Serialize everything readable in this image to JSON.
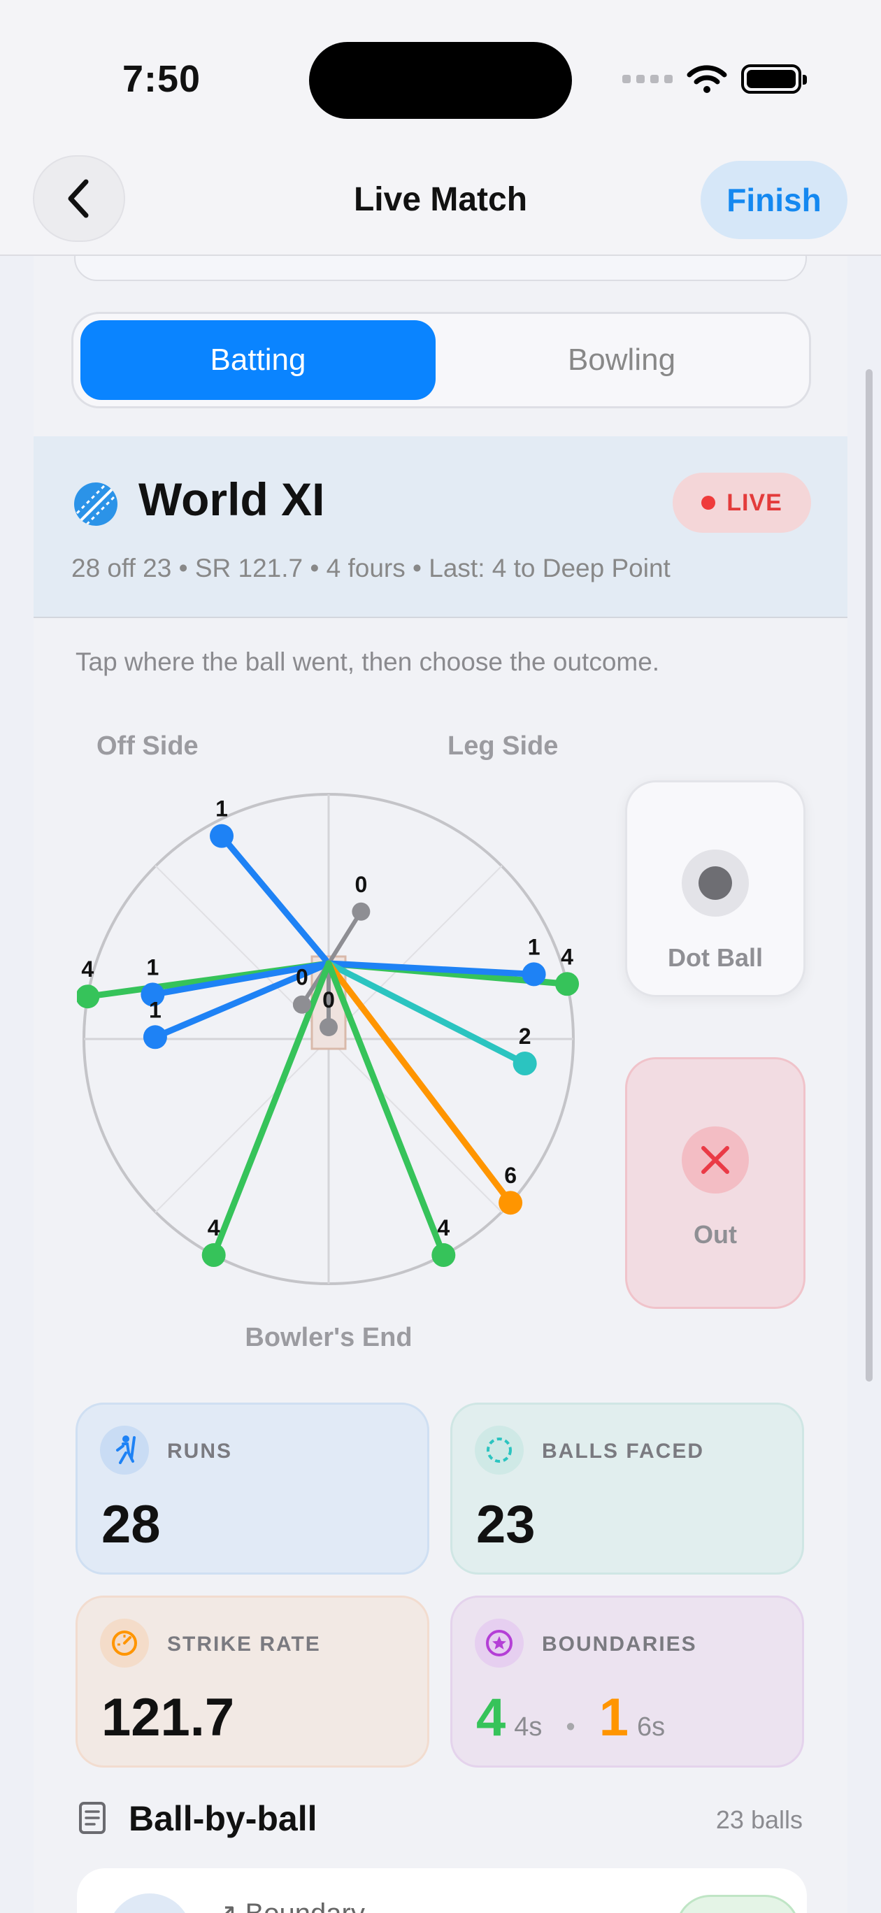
{
  "status": {
    "time": "7:50"
  },
  "nav": {
    "title": "Live Match",
    "finish": "Finish"
  },
  "tabs": {
    "batting": "Batting",
    "bowling": "Bowling"
  },
  "team": {
    "name": "World XI",
    "live": "LIVE",
    "stats": "28 off 23 • SR 121.7 • 4 fours • Last: 4 to Deep Point"
  },
  "wagon": {
    "hint": "Tap where the ball went, then choose the outcome.",
    "off_side": "Off Side",
    "leg_side": "Leg Side",
    "bowlers_end": "Bowler's End",
    "colors": {
      "0": "#8e8e93",
      "1": "#1e82f5",
      "2": "#2bc4c0",
      "4": "#36c35a",
      "6": "#ff9500"
    },
    "shots": [
      {
        "runs": 1,
        "angle_deg": 130,
        "distance": 0.68
      },
      {
        "runs": 4,
        "angle_deg": 170,
        "distance": 1.0
      },
      {
        "runs": 1,
        "angle_deg": 190,
        "distance": 0.73
      },
      {
        "runs": 1,
        "angle_deg": 203,
        "distance": 0.77
      },
      {
        "runs": 0,
        "angle_deg": 237,
        "distance": 0.2
      },
      {
        "runs": 0,
        "angle_deg": 270,
        "distance": 0.26
      },
      {
        "runs": 0,
        "angle_deg": 58,
        "distance": 0.25
      },
      {
        "runs": 4,
        "angle_deg": 13,
        "distance": 1.0
      },
      {
        "runs": 1,
        "angle_deg": -3,
        "distance": 0.84
      },
      {
        "runs": 2,
        "angle_deg": -27,
        "distance": 0.9
      },
      {
        "runs": 6,
        "angle_deg": -42,
        "distance": 1.0
      },
      {
        "runs": 4,
        "angle_deg": -62,
        "distance": 1.0
      },
      {
        "runs": 4,
        "angle_deg": 242,
        "distance": 1.0
      }
    ]
  },
  "actions": {
    "dot_ball": "Dot Ball",
    "out": "Out"
  },
  "stats": {
    "runs_label": "RUNS",
    "runs": "28",
    "balls_label": "BALLS FACED",
    "balls": "23",
    "sr_label": "STRIKE RATE",
    "sr": "121.7",
    "boundaries_label": "BOUNDARIES",
    "fours": "4",
    "fours_unit": "4s",
    "sep": "•",
    "sixes": "1",
    "sixes_unit": "6s",
    "fours_color": "#36c35a",
    "sixes_color": "#ff9500"
  },
  "ball_by_ball": {
    "title": "Ball-by-ball",
    "count": "23 balls",
    "first_item": "↗ Boundary"
  }
}
